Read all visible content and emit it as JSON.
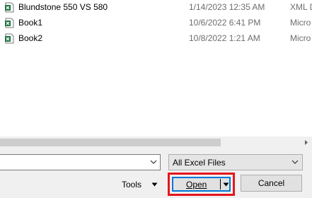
{
  "files": [
    {
      "name": "Blundstone 550 VS 580",
      "date": "1/14/2023 12:35 AM",
      "type": "XML D",
      "icon": "xml-file-icon"
    },
    {
      "name": "Book1",
      "date": "10/6/2022 6:41 PM",
      "type": "Micro",
      "icon": "excel-file-icon"
    },
    {
      "name": "Book2",
      "date": "10/8/2022 1:21 AM",
      "type": "Micro",
      "icon": "excel-file-icon"
    }
  ],
  "file_name_field": {
    "value": ""
  },
  "file_type_filter": {
    "selected": "All Excel Files"
  },
  "buttons": {
    "tools": "Tools",
    "open": "Open",
    "cancel": "Cancel"
  },
  "colors": {
    "highlight_border": "#e5161d",
    "focus_border": "#0078d7",
    "excel_green": "#1d6f42"
  }
}
